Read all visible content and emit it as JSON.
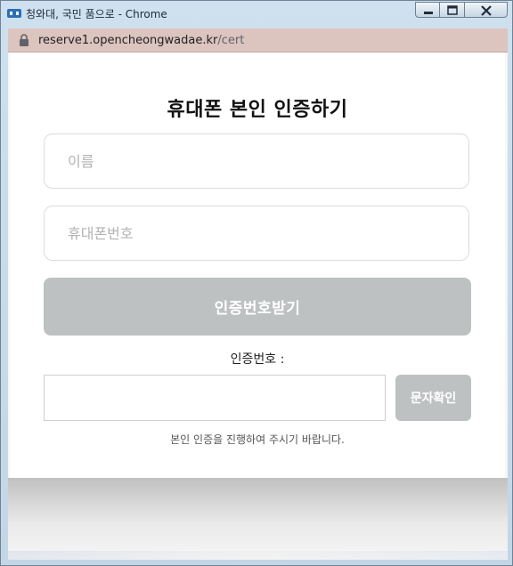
{
  "window": {
    "title": "청와대, 국민 품으로 - Chrome",
    "controls": [
      "minimize",
      "maximize",
      "close"
    ]
  },
  "addressbar": {
    "host": "reserve1.opencheongwadae.kr",
    "path": "/cert",
    "secure_icon": "lock-icon"
  },
  "modal": {
    "heading": "휴대폰 본인 인증하기",
    "name_placeholder": "이름",
    "phone_placeholder": "휴대폰번호",
    "request_code_label": "인증번호받기",
    "code_label": "인증번호 :",
    "code_value": "",
    "verify_label": "문자확인",
    "notice": "본인 인증을 진행하여 주시기 바랍니다."
  },
  "colors": {
    "button_disabled": "#bec1c2",
    "address_bar": "#dcc4bf",
    "window_frame": "#c2d6e6"
  }
}
